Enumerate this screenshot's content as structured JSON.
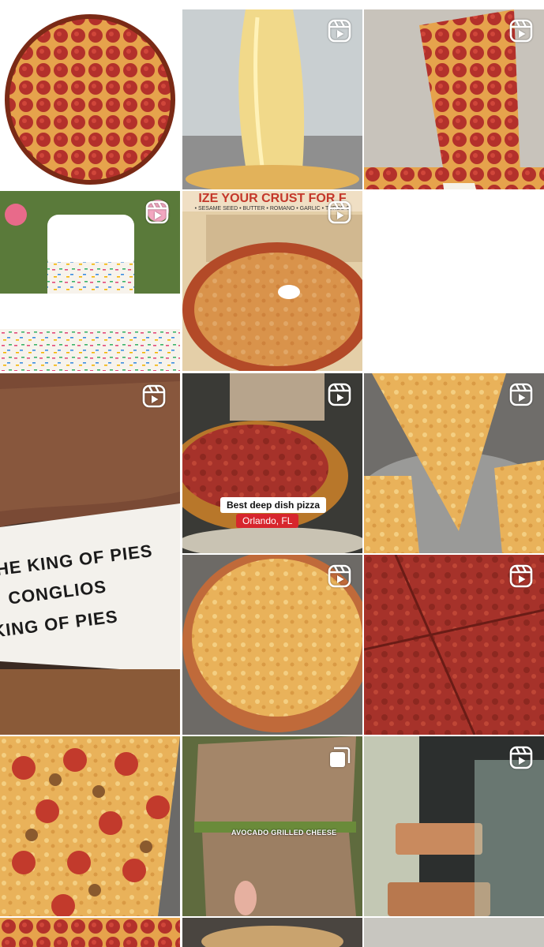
{
  "grid": {
    "tiles": [
      {
        "id": "t0",
        "kind": "image",
        "alt": "pepperoni-pizza-whole"
      },
      {
        "id": "t1",
        "kind": "reel",
        "alt": "cheese-pull"
      },
      {
        "id": "t2",
        "kind": "reel",
        "alt": "pizza-slice-ranch"
      },
      {
        "id": "t3",
        "kind": "reel",
        "alt": "funfetti-cake-bars"
      },
      {
        "id": "t4",
        "kind": "reel",
        "alt": "pizza-in-box"
      },
      {
        "id": "t5",
        "kind": "reel",
        "alt": "crust-closeup"
      },
      {
        "id": "t6",
        "kind": "reel",
        "alt": "deep-dish-pizza"
      },
      {
        "id": "t7",
        "kind": "reel",
        "alt": "cheese-slice-pull"
      },
      {
        "id": "t8",
        "kind": "reel",
        "alt": "cheese-pizza-tray"
      },
      {
        "id": "t9",
        "kind": "reel",
        "alt": "sauce-pizza-squares"
      },
      {
        "id": "t10",
        "kind": "image",
        "alt": "pepperoni-sausage-pizza"
      },
      {
        "id": "t11",
        "kind": "carousel",
        "alt": "avocado-grilled-cheese"
      },
      {
        "id": "t12",
        "kind": "reel",
        "alt": "copper-press-machine"
      }
    ]
  },
  "overlays": {
    "crust_banner": "IZE YOUR CRUST FOR F",
    "crust_banner_sub": "• SESAME SEED • BUTTER • ROMANO • GARLIC • TURBO C",
    "deep_dish_title": "Best deep dish pizza",
    "deep_dish_location": "Orlando, FL",
    "grilled_cheese_caption": "AVOCADO GRILLED CHEESE",
    "paper_line_1": "THE KING OF PIES",
    "paper_line_2": "CONGLIOS",
    "paper_line_3": "KING OF PIES"
  },
  "icons": {
    "reel_badge": "reels-icon",
    "carousel_badge": "carousel-icon"
  },
  "colors": {
    "badge": "#ffffff",
    "pepperoni": "#b8332a",
    "cheese": "#e9b75a",
    "location_pill": "#d7262d"
  }
}
